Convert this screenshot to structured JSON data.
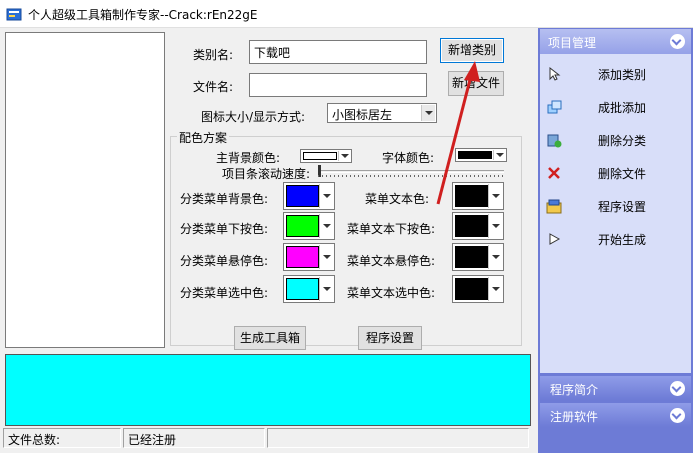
{
  "window": {
    "title": "个人超级工具箱制作专家--Crack:rEn22gE"
  },
  "form": {
    "category_label": "类别名:",
    "category_value": "下载吧",
    "add_category_button": "新增类别",
    "file_label": "文件名:",
    "file_value": "",
    "add_file_button": "新增文件",
    "icon_mode_label": "图标大小/显示方式:",
    "icon_mode_value": "小图标居左"
  },
  "colors_group": {
    "title": "配色方案",
    "main_bg_label": "主背景颜色:",
    "font_color_label": "字体颜色:",
    "scroll_speed_label": "项目条滚动速度:",
    "rows": [
      {
        "left_label": "分类菜单背景色:",
        "left_color": "#0000ff",
        "right_label": "菜单文本色:",
        "right_color": "#000000"
      },
      {
        "left_label": "分类菜单下按色:",
        "left_color": "#00ff00",
        "right_label": "菜单文本下按色:",
        "right_color": "#000000"
      },
      {
        "left_label": "分类菜单悬停色:",
        "left_color": "#ff00ff",
        "right_label": "菜单文本悬停色:",
        "right_color": "#000000"
      },
      {
        "left_label": "分类菜单选中色:",
        "left_color": "#00ffff",
        "right_label": "菜单文本选中色:",
        "right_color": "#000000"
      }
    ],
    "main_bg_color": "#ffffff",
    "font_color": "#000000"
  },
  "actions": {
    "generate_button": "生成工具箱",
    "settings_button": "程序设置"
  },
  "status": {
    "file_count": "文件总数:",
    "registered": "已经注册"
  },
  "sidebar": {
    "header": "项目管理",
    "items": [
      {
        "label": "添加类别",
        "icon": "cursor-icon"
      },
      {
        "label": "成批添加",
        "icon": "batch-add-icon"
      },
      {
        "label": "删除分类",
        "icon": "delete-category-icon"
      },
      {
        "label": "删除文件",
        "icon": "delete-x-icon"
      },
      {
        "label": "程序设置",
        "icon": "settings-icon"
      },
      {
        "label": "开始生成",
        "icon": "play-icon"
      }
    ],
    "section2": "程序简介",
    "section3": "注册软件"
  },
  "accent_colors": {
    "sidebar": "#6d7bd6",
    "preview": "#00ffff",
    "arrow": "#d02020"
  }
}
